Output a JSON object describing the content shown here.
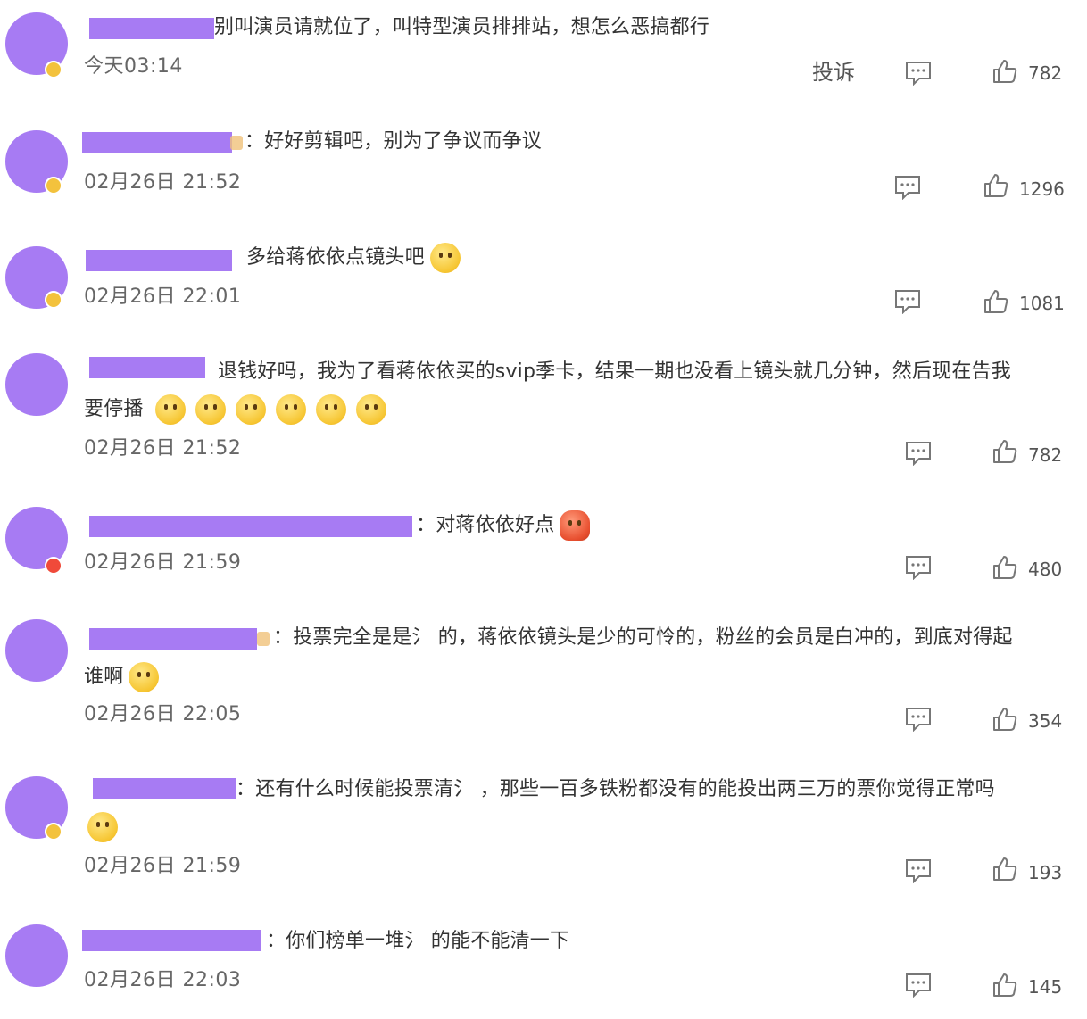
{
  "report_label": "投诉",
  "comments": [
    {
      "text1": "别叫演员请就位了，叫特型演员排排站，想怎么恶搞都行",
      "text2": "",
      "time": "今天03:14",
      "likes": "782",
      "badge": "gold"
    },
    {
      "text1": "：好好剪辑吧，别为了争议而争议",
      "text2": "",
      "time": "02月26日 21:52",
      "likes": "1296",
      "badge": "gold"
    },
    {
      "text1": "多给蒋依依点镜头吧",
      "text2": "",
      "time": "02月26日 22:01",
      "likes": "1081",
      "badge": "gold"
    },
    {
      "text1": "退钱好吗，我为了看蒋依依买的svip季卡，结果一期也没看上镜头就几分钟，然后现在告我",
      "text2": "要停播",
      "time": "02月26日 21:52",
      "likes": "782",
      "badge": "none"
    },
    {
      "text1": "：对蒋依依好点",
      "text2": "",
      "time": "02月26日 21:59",
      "likes": "480",
      "badge": "red"
    },
    {
      "text1": "：投票完全是是氵 的，蒋依依镜头是少的可怜的，粉丝的会员是白冲的，到底对得起",
      "text2": "谁啊",
      "time": "02月26日 22:05",
      "likes": "354",
      "badge": "none"
    },
    {
      "text1": "：还有什么时候能投票清氵 ，那些一百多铁粉都没有的能投出两三万的票你觉得正常吗",
      "text2": "",
      "time": "02月26日 21:59",
      "likes": "193",
      "badge": "gold"
    },
    {
      "text1": "：你们榜单一堆氵 的能不能清一下",
      "text2": "",
      "time": "02月26日 22:03",
      "likes": "145",
      "badge": "none"
    }
  ]
}
